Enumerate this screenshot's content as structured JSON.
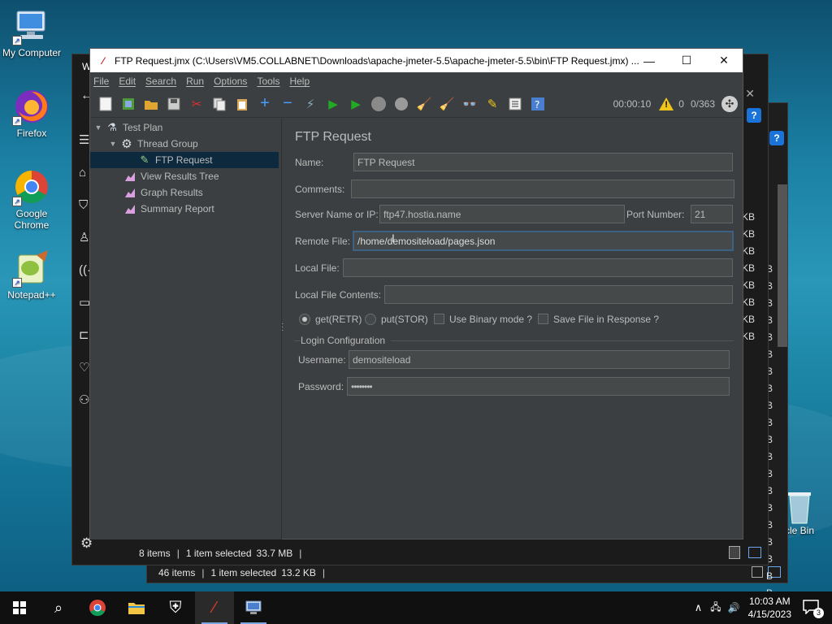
{
  "desktop": {
    "icons": [
      {
        "label": "My Computer",
        "icon": "computer-icon"
      },
      {
        "label": "Firefox",
        "icon": "firefox-icon"
      },
      {
        "label": "Google Chrome",
        "icon": "chrome-icon"
      },
      {
        "label": "Notepad++",
        "icon": "notepadpp-icon"
      },
      {
        "label": "cle Bin",
        "icon": "recycle-bin-icon"
      }
    ]
  },
  "bg_windows": {
    "win1_status": {
      "items": "8 items",
      "selected": "1 item selected",
      "size": "33.7 MB"
    },
    "win2_status": {
      "items": "46 items",
      "selected": "1 item selected",
      "size": "13.2 KB"
    },
    "size_column_labels": [
      "KB",
      "KB",
      "KB",
      "KB",
      "KB",
      "KB",
      "KB",
      "KB"
    ],
    "b_column_label": "B",
    "title_fragment": "W"
  },
  "jmeter": {
    "title": "FTP Request.jmx (C:\\Users\\VM5.COLLABNET\\Downloads\\apache-jmeter-5.5\\apache-jmeter-5.5\\bin\\FTP Request.jmx) ...",
    "menu": [
      "File",
      "Edit",
      "Search",
      "Run",
      "Options",
      "Tools",
      "Help"
    ],
    "toolbar": {
      "timer": "00:00:10",
      "warnings": "0",
      "threads": "0/363"
    },
    "tree": [
      {
        "label": "Test Plan",
        "icon": "test-plan-icon",
        "level": 0,
        "caret": "▼"
      },
      {
        "label": "Thread Group",
        "icon": "gear-icon",
        "level": 1,
        "caret": "▼"
      },
      {
        "label": "FTP Request",
        "icon": "pen-icon",
        "level": 2,
        "caret": ""
      },
      {
        "label": "View Results Tree",
        "icon": "chart-icon",
        "level": 1,
        "caret": ""
      },
      {
        "label": "Graph Results",
        "icon": "chart-icon",
        "level": 1,
        "caret": ""
      },
      {
        "label": "Summary Report",
        "icon": "chart-icon",
        "level": 1,
        "caret": ""
      }
    ],
    "panel": {
      "title": "FTP Request",
      "name_label": "Name:",
      "name_value": "FTP Request",
      "comments_label": "Comments:",
      "comments_value": "",
      "server_label": "Server Name or IP:",
      "server_value": "ftp47.hostia.name",
      "port_label": "Port Number:",
      "port_value": "21",
      "remote_label": "Remote File:",
      "remote_value": "/home/demositeload/pages.json",
      "local_label": "Local File:",
      "local_value": "",
      "contents_label": "Local File Contents:",
      "contents_value": "",
      "get_label": "get(RETR)",
      "put_label": "put(STOR)",
      "binary_label": "Use Binary mode ?",
      "save_label": "Save File in Response ?",
      "login_group": "Login Configuration",
      "username_label": "Username:",
      "username_value": "demositeload",
      "password_label": "Password:",
      "password_value": "••••••••"
    }
  },
  "taskbar": {
    "time": "10:03 AM",
    "date": "4/15/2023",
    "notifications": "3"
  },
  "colors": {
    "accent_selected": "#0d293e",
    "jmeter_bg": "#3c3f41",
    "field_bg": "#45494a",
    "focus_border": "#3d6185"
  }
}
